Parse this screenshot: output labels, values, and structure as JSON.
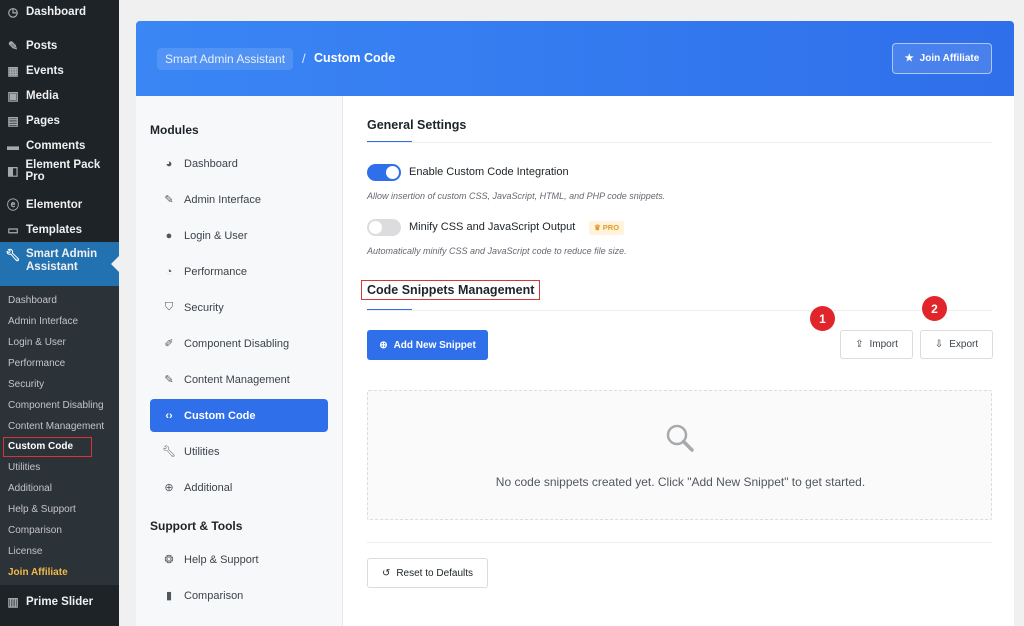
{
  "wp_menu": {
    "top_items": [
      {
        "label": "Dashboard",
        "icon": "dashboard-icon"
      },
      {
        "label": "Posts",
        "icon": "pin-icon"
      },
      {
        "label": "Events",
        "icon": "calendar-icon"
      },
      {
        "label": "Media",
        "icon": "media-icon"
      },
      {
        "label": "Pages",
        "icon": "page-icon"
      },
      {
        "label": "Comments",
        "icon": "comment-icon"
      },
      {
        "label": "Element Pack Pro",
        "icon": "element-pack-icon"
      },
      {
        "label": "Elementor",
        "icon": "elementor-icon"
      },
      {
        "label": "Templates",
        "icon": "folder-icon"
      }
    ],
    "active_item": {
      "label": "Smart Admin Assistant",
      "icon": "wrench-icon"
    },
    "submenu": [
      "Dashboard",
      "Admin Interface",
      "Login & User",
      "Performance",
      "Security",
      "Component Disabling",
      "Content Management",
      "Custom Code",
      "Utilities",
      "Additional",
      "Help & Support",
      "Comparison",
      "License",
      "Join Affiliate"
    ],
    "bottom_item": {
      "label": "Prime Slider",
      "icon": "slider-icon"
    }
  },
  "header": {
    "breadcrumb_root": "Smart Admin Assistant",
    "separator": "/",
    "breadcrumb_current": "Custom Code",
    "join_button": "Join Affiliate"
  },
  "modules": {
    "heading": "Modules",
    "items": [
      {
        "label": "Dashboard",
        "icon": "palette-icon"
      },
      {
        "label": "Admin Interface",
        "icon": "pin-icon"
      },
      {
        "label": "Login & User",
        "icon": "user-icon"
      },
      {
        "label": "Performance",
        "icon": "gauge-icon"
      },
      {
        "label": "Security",
        "icon": "shield-icon"
      },
      {
        "label": "Component Disabling",
        "icon": "brush-icon"
      },
      {
        "label": "Content Management",
        "icon": "pin-icon"
      },
      {
        "label": "Custom Code",
        "icon": "code-icon"
      },
      {
        "label": "Utilities",
        "icon": "wrench-icon"
      },
      {
        "label": "Additional",
        "icon": "plus-circle-icon"
      }
    ],
    "support_heading": "Support & Tools",
    "support_items": [
      {
        "label": "Help & Support",
        "icon": "lifebuoy-icon"
      },
      {
        "label": "Comparison",
        "icon": "bar-chart-icon"
      }
    ]
  },
  "general": {
    "title": "General Settings",
    "enable_label": "Enable Custom Code Integration",
    "enable_on": true,
    "enable_desc": "Allow insertion of custom CSS, JavaScript, HTML, and PHP code snippets.",
    "minify_label": "Minify CSS and JavaScript Output",
    "minify_on": false,
    "pro_badge": "♛ PRO",
    "minify_desc": "Automatically minify CSS and JavaScript code to reduce file size."
  },
  "snippets": {
    "title": "Code Snippets Management",
    "add_button": "Add New Snippet",
    "import_button": "Import",
    "export_button": "Export",
    "marker_1": "1",
    "marker_2": "2",
    "empty_text": "No code snippets created yet. Click \"Add New Snippet\" to get started."
  },
  "reset_button": "Reset to Defaults",
  "colors": {
    "accent": "#2f6fea",
    "sidebar_bg": "#1d2327",
    "highlight_red": "#e0262b",
    "affiliate_orange": "#f0b849"
  }
}
